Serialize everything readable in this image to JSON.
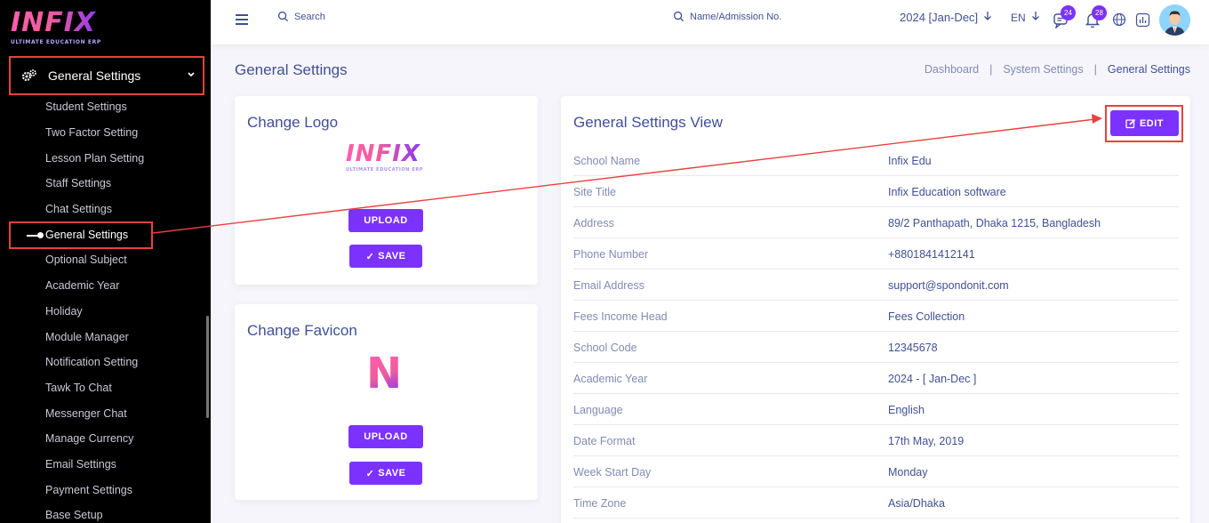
{
  "brand": {
    "logo": "INFIX",
    "tagline": "ULTIMATE EDUCATION ERP"
  },
  "sidebar": {
    "section_label": "General Settings",
    "items": [
      {
        "label": "Student Settings"
      },
      {
        "label": "Two Factor Setting"
      },
      {
        "label": "Lesson Plan Setting"
      },
      {
        "label": "Staff Settings"
      },
      {
        "label": "Chat Settings"
      },
      {
        "label": "General Settings",
        "active": true
      },
      {
        "label": "Optional Subject"
      },
      {
        "label": "Academic Year"
      },
      {
        "label": "Holiday"
      },
      {
        "label": "Module Manager"
      },
      {
        "label": "Notification Setting"
      },
      {
        "label": "Tawk To Chat"
      },
      {
        "label": "Messenger Chat"
      },
      {
        "label": "Manage Currency"
      },
      {
        "label": "Email Settings"
      },
      {
        "label": "Payment Settings"
      },
      {
        "label": "Base Setup"
      }
    ]
  },
  "topbar": {
    "search_label": "Search",
    "search2_label": "Name/Admission No.",
    "session": "2024 [Jan-Dec]",
    "language": "EN",
    "chat_badge": "24",
    "notif_badge": "28"
  },
  "page": {
    "title": "General Settings",
    "breadcrumb": [
      "Dashboard",
      "System Settings",
      "General Settings"
    ]
  },
  "logo_card": {
    "title": "Change Logo",
    "upload": "UPLOAD",
    "save": "SAVE"
  },
  "favicon_card": {
    "title": "Change Favicon",
    "favicon_letter": "N",
    "upload": "UPLOAD",
    "save": "SAVE"
  },
  "view": {
    "title": "General Settings View",
    "edit": "EDIT",
    "rows": [
      {
        "key": "School Name",
        "value": "Infix Edu"
      },
      {
        "key": "Site Title",
        "value": "Infix Education software"
      },
      {
        "key": "Address",
        "value": "89/2 Panthapath, Dhaka 1215, Bangladesh"
      },
      {
        "key": "Phone Number",
        "value": "+8801841412141"
      },
      {
        "key": "Email Address",
        "value": "support@spondonit.com"
      },
      {
        "key": "Fees Income Head",
        "value": "Fees Collection"
      },
      {
        "key": "School Code",
        "value": "12345678"
      },
      {
        "key": "Academic Year",
        "value": "2024 - [ Jan-Dec ]"
      },
      {
        "key": "Language",
        "value": "English"
      },
      {
        "key": "Date Format",
        "value": "17th May, 2019"
      },
      {
        "key": "Week Start Day",
        "value": "Monday"
      },
      {
        "key": "Time Zone",
        "value": "Asia/Dhaka"
      }
    ]
  },
  "colors": {
    "primary": "#7c32ff",
    "highlight": "#e9413f",
    "text": "#415094",
    "muted": "#828bb2"
  }
}
